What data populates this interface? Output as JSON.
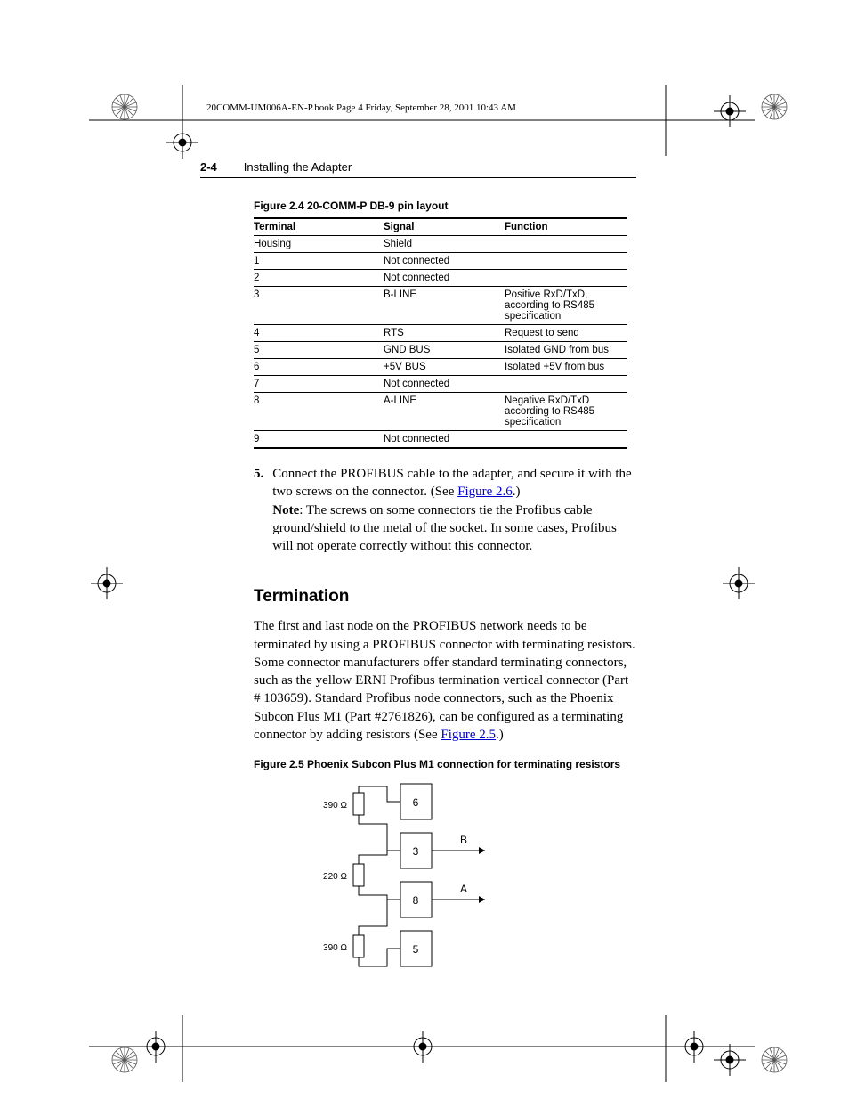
{
  "docinfo": "20COMM-UM006A-EN-P.book  Page 4  Friday, September 28, 2001  10:43 AM",
  "header": {
    "page_num": "2-4",
    "title": "Installing the Adapter"
  },
  "fig24": {
    "caption": "Figure 2.4   20-COMM-P DB-9 pin layout",
    "head": {
      "t": "Terminal",
      "s": "Signal",
      "f": "Function"
    },
    "rows": [
      {
        "t": "Housing",
        "s": "Shield",
        "f": ""
      },
      {
        "t": "1",
        "s": "Not connected",
        "f": ""
      },
      {
        "t": "2",
        "s": "Not connected",
        "f": ""
      },
      {
        "t": "3",
        "s": "B-LINE",
        "f": "Positive RxD/TxD, according to RS485 specification"
      },
      {
        "t": "4",
        "s": "RTS",
        "f": "Request to send"
      },
      {
        "t": "5",
        "s": "GND BUS",
        "f": "Isolated GND from bus"
      },
      {
        "t": "6",
        "s": "+5V BUS",
        "f": "Isolated +5V from bus"
      },
      {
        "t": "7",
        "s": "Not connected",
        "f": ""
      },
      {
        "t": "8",
        "s": "A-LINE",
        "f": "Negative RxD/TxD according to RS485 specification"
      },
      {
        "t": "9",
        "s": "Not connected",
        "f": ""
      }
    ]
  },
  "step5": {
    "num": "5.",
    "text1": "Connect the PROFIBUS cable to the adapter, and secure it with the two screws on the connector. (See ",
    "link1": "Figure 2.6",
    "text2": ".)",
    "note_label": "Note",
    "note_text": ": The screws on some connectors tie the Profibus cable ground/shield to the metal of the socket. In some cases, Profibus will not operate correctly without this connector."
  },
  "termination": {
    "heading": "Termination",
    "para1": "The first and last node on the PROFIBUS network needs to be terminated by using a PROFIBUS connector with terminating resistors. Some connector manufacturers offer standard terminating connectors, such as the yellow ERNI Profibus termination vertical connector (Part # 103659). Standard Profibus node connectors, such as the Phoenix Subcon Plus M1 (Part #2761826), can be configured as a terminating connector by adding resistors (See ",
    "link": "Figure 2.5",
    "para2": ".)"
  },
  "fig25": {
    "caption": "Figure 2.5   Phoenix Subcon Plus M1 connection for terminating resistors",
    "r1": "390 Ω",
    "r2": "220 Ω",
    "r3": "390 Ω",
    "p6": "6",
    "p3": "3",
    "p8": "8",
    "p5": "5",
    "b": "B",
    "a": "A"
  }
}
